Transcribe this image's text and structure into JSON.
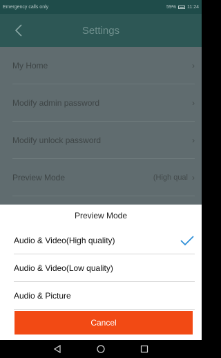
{
  "status_bar": {
    "left_text": "Emergency calls only",
    "battery": "59%",
    "time": "11:24"
  },
  "header": {
    "title": "Settings",
    "back_icon": "chevron-left-icon"
  },
  "settings": {
    "items": [
      {
        "label": "My Home"
      },
      {
        "label": "Modify admin password"
      },
      {
        "label": "Modify unlock password"
      },
      {
        "label": "Preview Mode",
        "value": "(High qual"
      }
    ],
    "chevron": "›"
  },
  "sheet": {
    "title": "Preview Mode",
    "options": [
      {
        "label": "Audio & Video(High quality)",
        "selected": true
      },
      {
        "label": "Audio & Video(Low quality)",
        "selected": false
      },
      {
        "label": "Audio & Picture",
        "selected": false
      }
    ],
    "cancel_label": "Cancel"
  },
  "colors": {
    "accent": "#2f8fd8",
    "cancel": "#f24a14",
    "header": "#2d5755"
  }
}
